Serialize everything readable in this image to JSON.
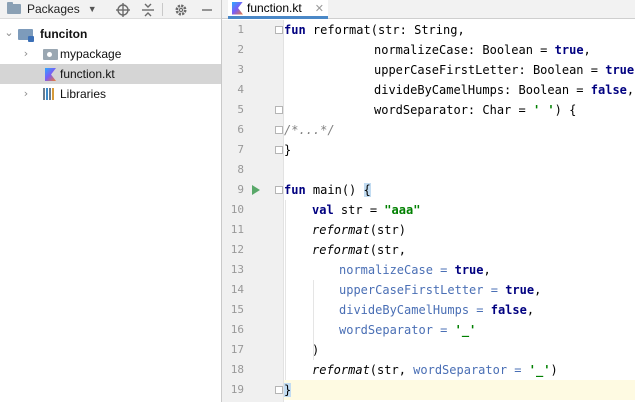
{
  "project_panel": {
    "view_selector": "Packages",
    "tree": [
      {
        "label": "funciton",
        "type": "module",
        "expanded": true
      },
      {
        "label": "mypackage",
        "type": "package",
        "expanded": false
      },
      {
        "label": "function.kt",
        "type": "kotlin-file",
        "selected": true
      },
      {
        "label": "Libraries",
        "type": "libraries",
        "expanded": false
      }
    ]
  },
  "editor": {
    "tab_label": "function.kt",
    "line_numbers": [
      "1",
      "2",
      "3",
      "4",
      "5",
      "6",
      "7",
      "8",
      "9",
      "10",
      "11",
      "12",
      "13",
      "14",
      "15",
      "16",
      "17",
      "18",
      "19"
    ]
  },
  "code": {
    "l1": {
      "kw": "fun",
      "fn": "reformat",
      "p": "str",
      "t": "String,"
    },
    "l2": {
      "p": "normalizeCase",
      "t": "Boolean",
      "v": "true"
    },
    "l3": {
      "p": "upperCaseFirstLetter",
      "t": "Boolean",
      "v": "true"
    },
    "l4": {
      "p": "divideByCamelHumps",
      "t": "Boolean",
      "v": "false"
    },
    "l5": {
      "p": "wordSeparator",
      "t": "Char",
      "v": "' '",
      "end": ") {"
    },
    "l6": {
      "cmt": "/*...*/"
    },
    "l7": {
      "t": "}"
    },
    "l9": {
      "kw": "fun",
      "fn": "main() ",
      "brace": "{"
    },
    "l10": {
      "kw": "val",
      "t": "str",
      "v": "\"aaa\""
    },
    "l11": {
      "fn": "reformat",
      "t": "(str)"
    },
    "l12": {
      "fn": "reformat",
      "t": "(str,"
    },
    "l13": {
      "p": "normalizeCase",
      "v": "true"
    },
    "l14": {
      "p": "upperCaseFirstLetter",
      "v": "true"
    },
    "l15": {
      "p": "divideByCamelHumps",
      "v": "false"
    },
    "l16": {
      "p": "wordSeparator",
      "v": "'_'"
    },
    "l17": {
      "t": ")"
    },
    "l18": {
      "fn": "reformat",
      "t": "(str, ",
      "p": "wordSeparator",
      "v": "'_'",
      "end": ")"
    },
    "l19": {
      "brace": "}"
    }
  },
  "colors": {
    "keyword": "#000080",
    "string": "#008000",
    "named_argument": "#4a6fb5",
    "comment": "#808080",
    "current_line": "#fefae2",
    "tab_underline": "#4a88c7"
  },
  "icons": [
    "folder-icon",
    "crosshair-icon",
    "collapse-icon",
    "gear-icon",
    "minimize-icon",
    "kotlin-file-icon",
    "run-icon"
  ]
}
